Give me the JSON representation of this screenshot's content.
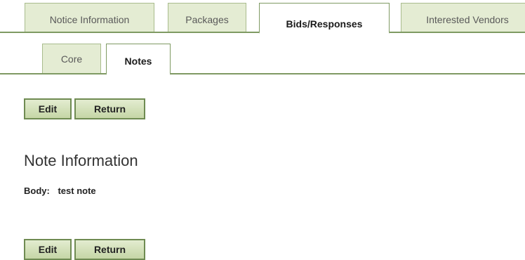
{
  "tabs_primary": [
    {
      "label": "Notice Information",
      "active": false
    },
    {
      "label": "Packages",
      "active": false
    },
    {
      "label": "Bids/Responses",
      "active": true
    },
    {
      "label": "Interested Vendors",
      "active": false
    }
  ],
  "tabs_secondary": [
    {
      "label": "Core",
      "active": false
    },
    {
      "label": "Notes",
      "active": true
    }
  ],
  "actions_top": {
    "edit_label": "Edit",
    "return_label": "Return"
  },
  "note": {
    "section_title": "Note Information",
    "body_label": "Body:",
    "body_value": "test note"
  },
  "actions_bottom": {
    "edit_label": "Edit",
    "return_label": "Return"
  },
  "colors": {
    "tab_inactive_bg": "#e4ecd3",
    "tab_border": "#7f9a63",
    "button_bg": "#c5d6a6",
    "button_border": "#6f8b52"
  }
}
